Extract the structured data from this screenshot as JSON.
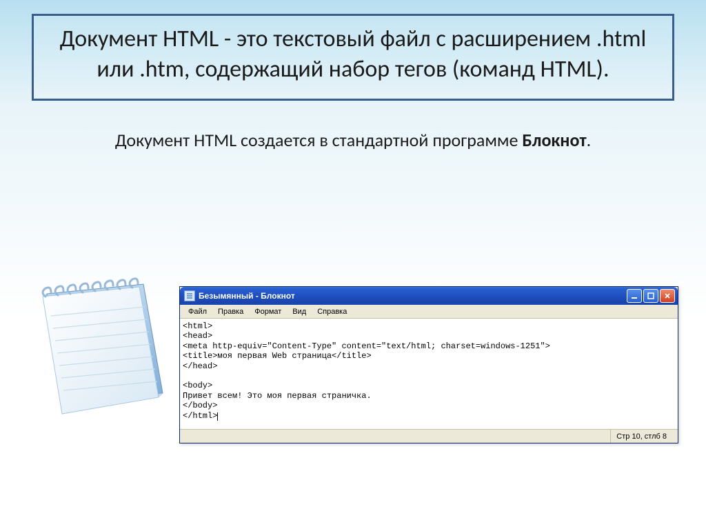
{
  "heading": {
    "full": "Документ HTML - это текстовый файл с расширением .html или .htm, содержащий набор тегов (команд HTML)."
  },
  "subtitle": {
    "prefix": "Документ HTML создается в стандартной программе ",
    "bold": "Блокнот",
    "suffix": "."
  },
  "notepad_window": {
    "title": "Безымянный - Блокнот",
    "menu": {
      "file": "Файл",
      "edit": "Правка",
      "format": "Формат",
      "view": "Вид",
      "help": "Справка"
    },
    "content_lines": [
      "<html>",
      "<head>",
      "<meta http-equiv=\"Content-Type\" content=\"text/html; charset=windows-1251\">",
      "<title>моя первая Web страница</title>",
      "</head>",
      "",
      "<body>",
      "Привет всем! Это моя первая страничка.",
      "</body>",
      "</html>"
    ],
    "status": "Стр 10, стлб 8"
  },
  "icons": {
    "minimize": "minimize-icon",
    "maximize": "maximize-icon",
    "close": "close-icon",
    "app": "notepad-app-icon"
  }
}
